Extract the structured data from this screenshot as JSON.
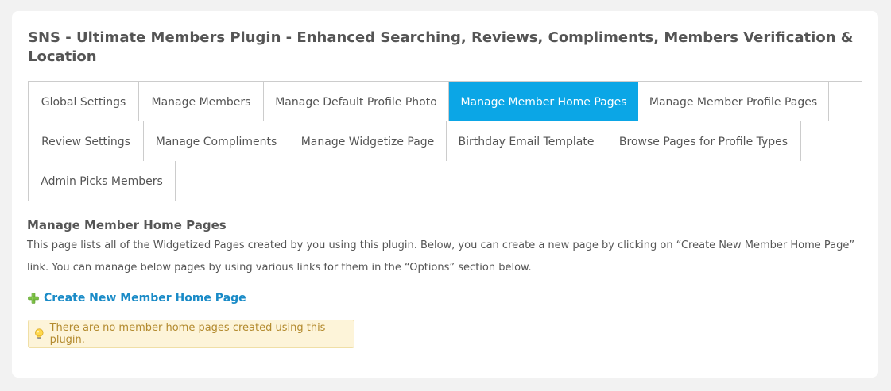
{
  "header": {
    "title": "SNS - Ultimate Members Plugin - Enhanced Searching, Reviews, Compliments, Members Verification & Location"
  },
  "tabs": [
    {
      "label": "Global Settings",
      "active": false
    },
    {
      "label": "Manage Members",
      "active": false
    },
    {
      "label": "Manage Default Profile Photo",
      "active": false
    },
    {
      "label": "Manage Member Home Pages",
      "active": true
    },
    {
      "label": "Manage Member Profile Pages",
      "active": false
    },
    {
      "label": "Review Settings",
      "active": false
    },
    {
      "label": "Manage Compliments",
      "active": false
    },
    {
      "label": "Manage Widgetize Page",
      "active": false
    },
    {
      "label": "Birthday Email Template",
      "active": false
    },
    {
      "label": "Browse Pages for Profile Types",
      "active": false
    },
    {
      "label": "Admin Picks Members",
      "active": false
    }
  ],
  "content": {
    "section_title": "Manage Member Home Pages",
    "description": "This page lists all of the Widgetized Pages created by you using this plugin. Below, you can create a new page by clicking on “Create New Member Home Page” link. You can manage below pages by using various links for them in the “Options” section below.",
    "create_link": {
      "label": "Create New Member Home Page",
      "icon": "plus-icon"
    },
    "notice": {
      "icon": "lightbulb-icon",
      "text": "There are no member home pages created using this plugin."
    }
  },
  "colors": {
    "active_tab": "#0ba6e6",
    "link": "#1a8bc7",
    "notice_background": "#fdf4d9",
    "notice_text": "#b38a2e",
    "plus_icon": "#7bc043"
  }
}
